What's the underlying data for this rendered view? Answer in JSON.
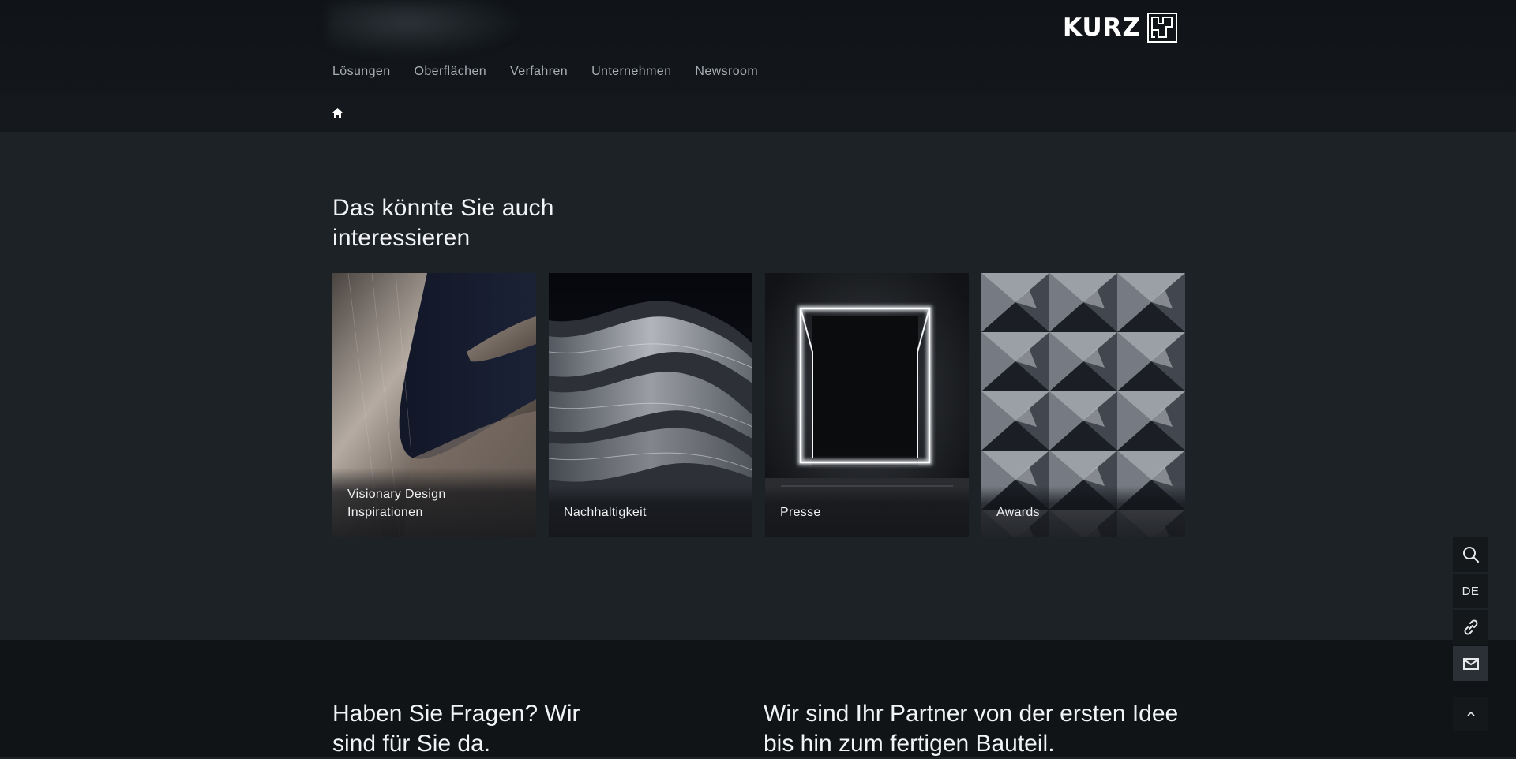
{
  "brand": {
    "name": "KURZ"
  },
  "nav": {
    "items": [
      "Lösungen",
      "Oberflächen",
      "Verfahren",
      "Unternehmen",
      "Newsroom"
    ]
  },
  "breadcrumb": {
    "icon": "home-icon"
  },
  "related": {
    "title": "Das könnte Sie auch interessieren",
    "cards": [
      {
        "lines": [
          "Visionary Design",
          "Inspirationen"
        ],
        "image": "brushed-metal-curve"
      },
      {
        "lines": [
          "Nachhaltigkeit"
        ],
        "image": "silver-waves"
      },
      {
        "lines": [
          "Presse"
        ],
        "image": "neon-doorframe"
      },
      {
        "lines": [
          "Awards"
        ],
        "image": "geometric-relief"
      }
    ]
  },
  "footer": {
    "left_text": "Haben Sie Fragen? Wir sind für Sie da.",
    "right_text": "Wir sind Ihr Partner von der ersten Idee bis hin zum fertigen Bauteil."
  },
  "toolbar": {
    "language": "DE",
    "icons": [
      "search-icon",
      "link-icon",
      "mail-icon",
      "chevron-up-icon"
    ]
  },
  "colors": {
    "background": "#1d2226",
    "header": "#101418",
    "footer": "#111417",
    "text": "#f2f3f4",
    "nav_text": "#a9aeb3"
  }
}
